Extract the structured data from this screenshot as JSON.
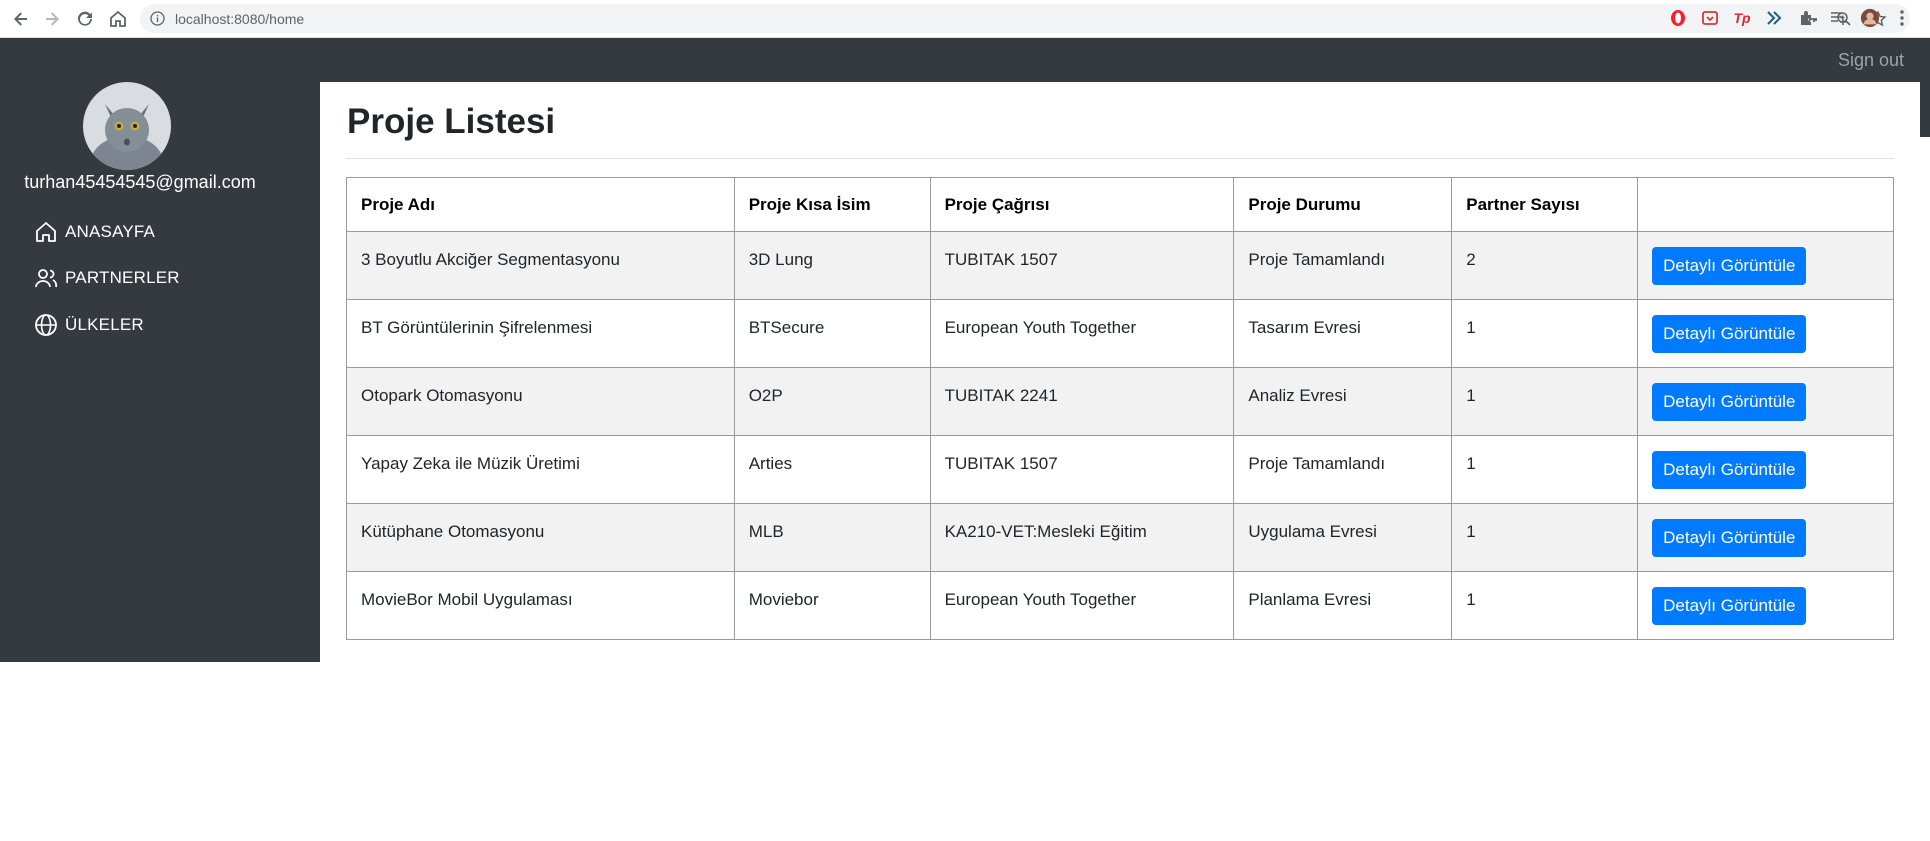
{
  "browser": {
    "url": "localhost:8080/home"
  },
  "topbar": {
    "signout_label": "Sign out"
  },
  "sidebar": {
    "email": "turhan45454545@gmail.com",
    "items": [
      {
        "label": "ANASAYFA",
        "icon": "home-icon"
      },
      {
        "label": "PARTNERLER",
        "icon": "users-icon"
      },
      {
        "label": "ÜLKELER",
        "icon": "globe-icon"
      }
    ]
  },
  "main": {
    "title": "Proje Listesi",
    "table": {
      "headers": [
        "Proje Adı",
        "Proje Kısa İsim",
        "Proje Çağrısı",
        "Proje Durumu",
        "Partner Sayısı",
        ""
      ],
      "button_label": "Detaylı Görüntüle",
      "rows": [
        {
          "name": "3 Boyutlu Akciğer Segmentasyonu",
          "short": "3D Lung",
          "call": "TUBITAK 1507",
          "status": "Proje Tamamlandı",
          "partners": "2"
        },
        {
          "name": "BT Görüntülerinin Şifrelenmesi",
          "short": "BTSecure",
          "call": "European Youth Together",
          "status": "Tasarım Evresi",
          "partners": "1"
        },
        {
          "name": "Otopark Otomasyonu",
          "short": "O2P",
          "call": "TUBITAK 2241",
          "status": "Analiz Evresi",
          "partners": "1"
        },
        {
          "name": "Yapay Zeka ile Müzik Üretimi",
          "short": "Arties",
          "call": "TUBITAK 1507",
          "status": "Proje Tamamlandı",
          "partners": "1"
        },
        {
          "name": "Kütüphane Otomasyonu",
          "short": "MLB",
          "call": "KA210-VET:Mesleki Eğitim",
          "status": "Uygulama Evresi",
          "partners": "1"
        },
        {
          "name": "MovieBor Mobil Uygulaması",
          "short": "Moviebor",
          "call": "European Youth Together",
          "status": "Planlama Evresi",
          "partners": "1"
        }
      ]
    }
  },
  "colors": {
    "dark": "#343a40",
    "primary": "#007bff",
    "stripe": "#f2f2f2"
  }
}
